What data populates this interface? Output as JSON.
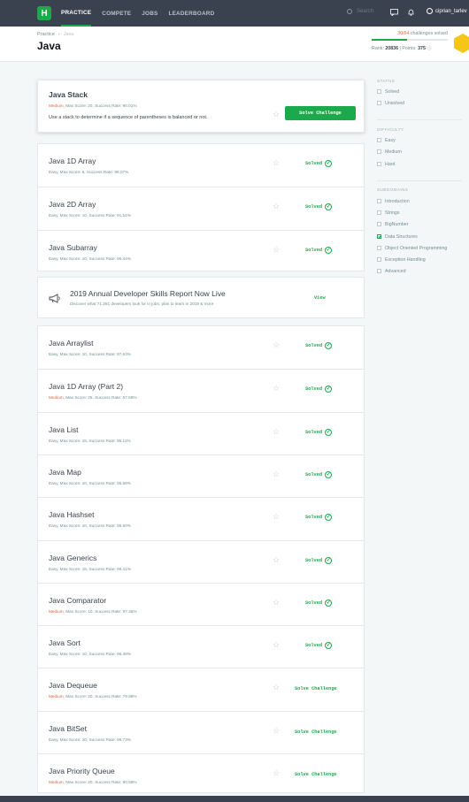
{
  "nav": {
    "logo": "H",
    "items": [
      "PRACTICE",
      "COMPETE",
      "JOBS",
      "LEADERBOARD"
    ],
    "search_placeholder": "Search",
    "username": "ciprian_tarlev"
  },
  "header": {
    "breadcrumb": [
      "Practice",
      "Java"
    ],
    "title": "Java",
    "progress_count": "30/64",
    "progress_text": "challenges solved",
    "progress_fraction": 0.47,
    "rank_label": "Rank:",
    "rank_value": "20836",
    "points_label": "Points:",
    "points_value": "375"
  },
  "featured": {
    "title": "Java Stack",
    "difficulty": "Medium",
    "meta": ", Max Score: 20, Success Rate: 90.01%",
    "description": "Use a stack to determine if a sequence of parentheses is balanced or not.",
    "button": "Solve Challenge"
  },
  "challenges_a": [
    {
      "title": "Java 1D Array",
      "difficulty": "Easy",
      "meta": ", Max Score: 5, Success Rate: 98.07%",
      "status": "Solved"
    },
    {
      "title": "Java 2D Array",
      "difficulty": "Easy",
      "meta": ", Max Score: 10, Success Rate: 91.54%",
      "status": "Solved"
    },
    {
      "title": "Java Subarray",
      "difficulty": "Easy",
      "meta": ", Max Score: 10, Success Rate: 96.44%",
      "status": "Solved"
    }
  ],
  "promo": {
    "title": "2019 Annual Developer Skills Report Now Live",
    "subtitle": "Discover what 71,281 developers look for in jobs, plan to learn in 2019 & more",
    "button": "View"
  },
  "challenges_b": [
    {
      "title": "Java Arraylist",
      "difficulty": "Easy",
      "meta": ", Max Score: 10, Success Rate: 97.63%",
      "status": "Solved"
    },
    {
      "title": "Java 1D Array (Part 2)",
      "difficulty": "Medium",
      "meta": ", Max Score: 25, Success Rate: 57.69%",
      "status": "Solved"
    },
    {
      "title": "Java List",
      "difficulty": "Easy",
      "meta": ", Max Score: 15, Success Rate: 96.11%",
      "status": "Solved"
    },
    {
      "title": "Java Map",
      "difficulty": "Easy",
      "meta": ", Max Score: 10, Success Rate: 95.68%",
      "status": "Solved"
    },
    {
      "title": "Java Hashset",
      "difficulty": "Easy",
      "meta": ", Max Score: 10, Success Rate: 95.50%",
      "status": "Solved"
    },
    {
      "title": "Java Generics",
      "difficulty": "Easy",
      "meta": ", Max Score: 15, Success Rate: 99.41%",
      "status": "Solved"
    },
    {
      "title": "Java Comparator",
      "difficulty": "Medium",
      "meta": ", Max Score: 10, Success Rate: 97.36%",
      "status": "Solved"
    },
    {
      "title": "Java Sort",
      "difficulty": "Easy",
      "meta": ", Max Score: 10, Success Rate: 96.48%",
      "status": "Solved"
    },
    {
      "title": "Java Dequeue",
      "difficulty": "Medium",
      "meta": ", Max Score: 20, Success Rate: 79.98%",
      "status": "Solve Challenge"
    },
    {
      "title": "Java BitSet",
      "difficulty": "Easy",
      "meta": ", Max Score: 20, Success Rate: 96.73%",
      "status": "Solve Challenge"
    },
    {
      "title": "Java Priority Queue",
      "difficulty": "Medium",
      "meta": ", Max Score: 20, Success Rate: 90.58%",
      "status": "Solve Challenge"
    }
  ],
  "filters": {
    "status_heading": "STATUS",
    "status": [
      "Solved",
      "Unsolved"
    ],
    "difficulty_heading": "DIFFICULTY",
    "difficulty": [
      "Easy",
      "Medium",
      "Hard"
    ],
    "subdomains_heading": "SUBDOMAINS",
    "subdomains": [
      "Introduction",
      "Strings",
      "BigNumber",
      "Data Structures",
      "Object Oriented Programming",
      "Exception Handling",
      "Advanced"
    ],
    "checked_subdomain": "Data Structures"
  },
  "colors": {
    "brand": "#1ba94c",
    "medium": "#e0673a",
    "nav_bg": "#39424e"
  }
}
